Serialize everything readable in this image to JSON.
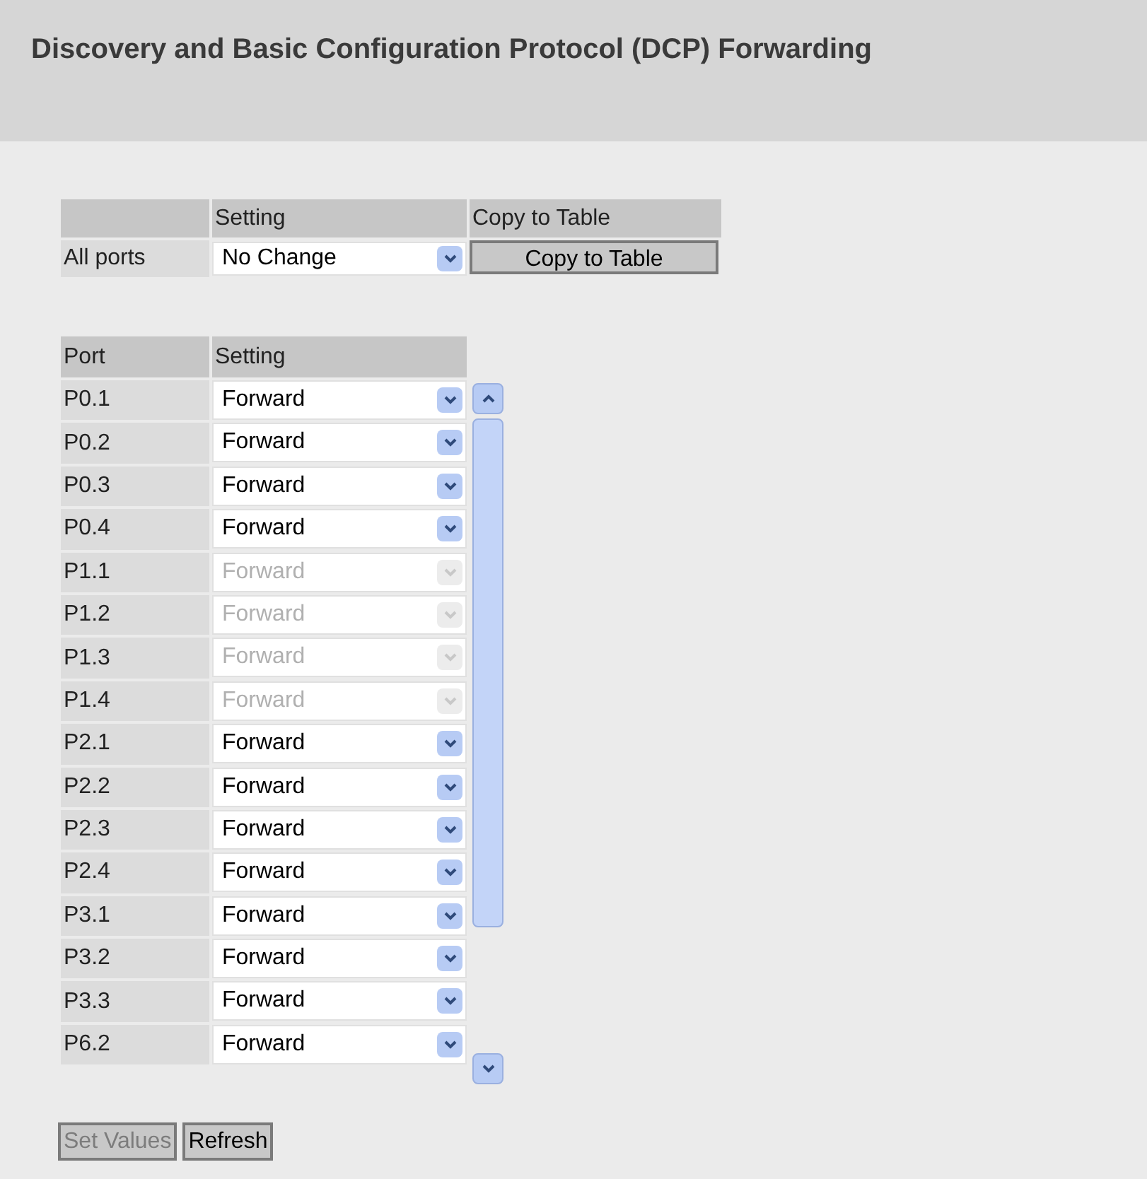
{
  "title": "Discovery and Basic Configuration Protocol (DCP) Forwarding",
  "copy_table": {
    "columns": [
      "Setting",
      "Copy to Table"
    ],
    "row_label": "All ports",
    "setting": "No Change",
    "button": "Copy to Table"
  },
  "ports_table": {
    "columns": [
      "Port",
      "Setting"
    ],
    "rows": [
      {
        "port": "P0.1",
        "setting": "Forward",
        "disabled": false
      },
      {
        "port": "P0.2",
        "setting": "Forward",
        "disabled": false
      },
      {
        "port": "P0.3",
        "setting": "Forward",
        "disabled": false
      },
      {
        "port": "P0.4",
        "setting": "Forward",
        "disabled": false
      },
      {
        "port": "P1.1",
        "setting": "Forward",
        "disabled": true
      },
      {
        "port": "P1.2",
        "setting": "Forward",
        "disabled": true
      },
      {
        "port": "P1.3",
        "setting": "Forward",
        "disabled": true
      },
      {
        "port": "P1.4",
        "setting": "Forward",
        "disabled": true
      },
      {
        "port": "P2.1",
        "setting": "Forward",
        "disabled": false
      },
      {
        "port": "P2.2",
        "setting": "Forward",
        "disabled": false
      },
      {
        "port": "P2.3",
        "setting": "Forward",
        "disabled": false
      },
      {
        "port": "P2.4",
        "setting": "Forward",
        "disabled": false
      },
      {
        "port": "P3.1",
        "setting": "Forward",
        "disabled": false
      },
      {
        "port": "P3.2",
        "setting": "Forward",
        "disabled": false
      },
      {
        "port": "P3.3",
        "setting": "Forward",
        "disabled": false
      },
      {
        "port": "P6.2",
        "setting": "Forward",
        "disabled": false
      }
    ]
  },
  "buttons": [
    {
      "label": "Set Values",
      "disabled": true
    },
    {
      "label": "Refresh",
      "disabled": false
    }
  ]
}
